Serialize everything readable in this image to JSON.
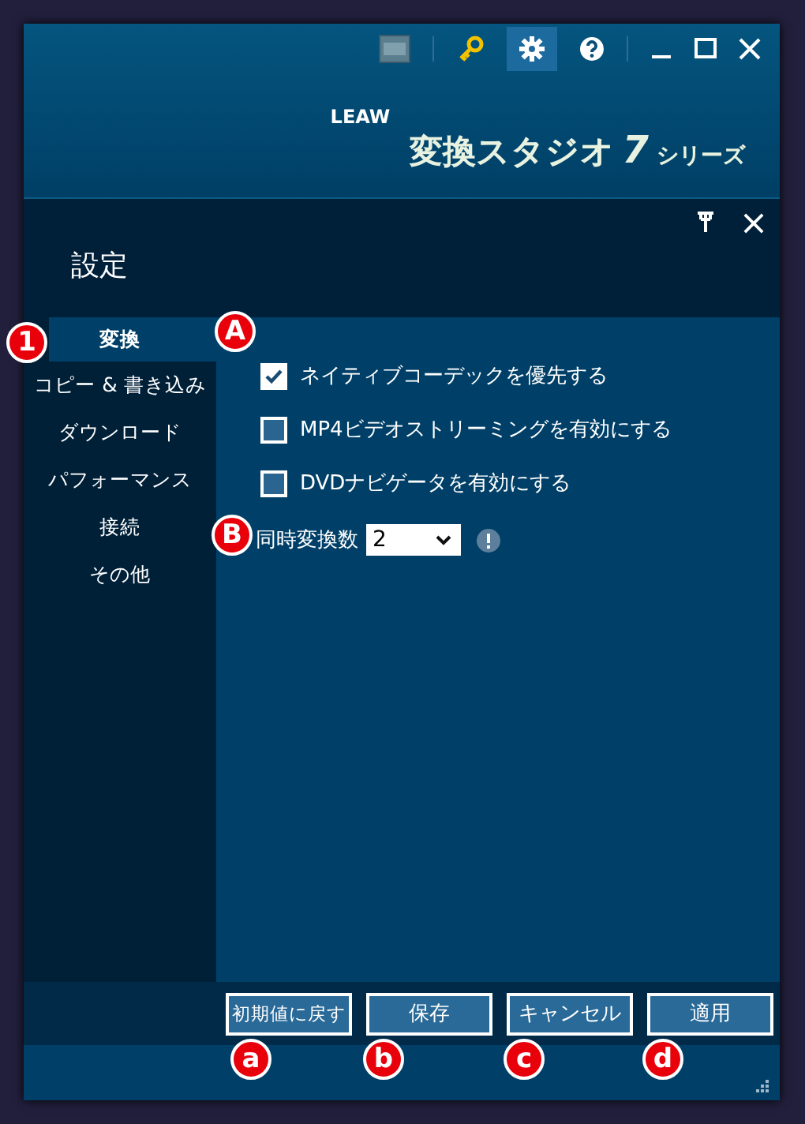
{
  "logo": {
    "brand": "LEAW",
    "product": "変換スタジオ",
    "version": "7",
    "series": "シリーズ"
  },
  "panel": {
    "title": "設定"
  },
  "sidebar": {
    "items": [
      {
        "label": "変換",
        "selected": true
      },
      {
        "label": "コピー & 書き込み",
        "selected": false
      },
      {
        "label": "ダウンロード",
        "selected": false
      },
      {
        "label": "パフォーマンス",
        "selected": false
      },
      {
        "label": "接続",
        "selected": false
      },
      {
        "label": "その他",
        "selected": false
      }
    ]
  },
  "options": [
    {
      "label": "ネイティブコーデックを優先する",
      "checked": true
    },
    {
      "label": "MP4ビデオストリーミングを有効にする",
      "checked": false
    },
    {
      "label": "DVDナビゲータを有効にする",
      "checked": false
    }
  ],
  "concurrent": {
    "label": "同時変換数",
    "value": "2"
  },
  "buttons": [
    "初期値に戻す",
    "保存",
    "キャンセル",
    "適用"
  ],
  "markers": [
    {
      "label": "1"
    },
    {
      "label": "A"
    },
    {
      "label": "B"
    },
    {
      "label": "a"
    },
    {
      "label": "b"
    },
    {
      "label": "c"
    },
    {
      "label": "d"
    }
  ]
}
